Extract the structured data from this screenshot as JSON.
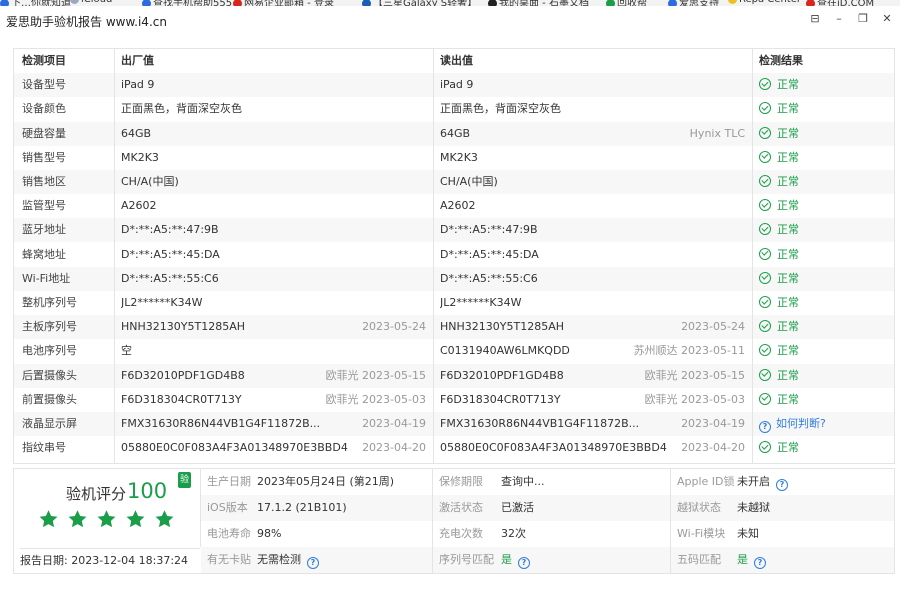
{
  "bookmarks": [
    {
      "label": "下…你就知道",
      "color": "#2b6de0"
    },
    {
      "label": "iCloud",
      "color": "#9aa9c0"
    },
    {
      "label": "查找手机帮助555",
      "color": "#2b6de0"
    },
    {
      "label": "网易企业邮箱 - 登录",
      "color": "#d9261c"
    },
    {
      "label": "【三星Galaxy S轻奢】",
      "color": "#1a5fb4"
    },
    {
      "label": "我的桌面 - 石墨文档",
      "color": "#222222"
    },
    {
      "label": "回收帮",
      "color": "#1a9e4a"
    },
    {
      "label": "爱思支持",
      "color": "#2b6de0"
    },
    {
      "label": "Repa Center",
      "color": "#f0c020"
    },
    {
      "label": "查在iD.COM",
      "color": "#d9261c"
    }
  ],
  "window": {
    "title": "爱思助手验机报告 www.i4.cn",
    "btn_restore": "⊟",
    "btn_min": "–",
    "btn_max": "❐",
    "btn_close": "✕"
  },
  "table": {
    "headers": [
      "检测项目",
      "出厂值",
      "读出值",
      "检测结果"
    ],
    "rows": [
      {
        "item": "设备型号",
        "factory": "iPad 9",
        "factory_meta": "",
        "read": "iPad 9",
        "read_meta": "",
        "result": "正常",
        "status": "ok"
      },
      {
        "item": "设备颜色",
        "factory": "正面黑色，背面深空灰色",
        "factory_meta": "",
        "read": "正面黑色，背面深空灰色",
        "read_meta": "",
        "result": "正常",
        "status": "ok"
      },
      {
        "item": "硬盘容量",
        "factory": "64GB",
        "factory_meta": "",
        "read": "64GB",
        "read_meta": "Hynix TLC",
        "result": "正常",
        "status": "ok"
      },
      {
        "item": "销售型号",
        "factory": "MK2K3",
        "factory_meta": "",
        "read": "MK2K3",
        "read_meta": "",
        "result": "正常",
        "status": "ok"
      },
      {
        "item": "销售地区",
        "factory": "CH/A(中国)",
        "factory_meta": "",
        "read": "CH/A(中国)",
        "read_meta": "",
        "result": "正常",
        "status": "ok"
      },
      {
        "item": "监管型号",
        "factory": "A2602",
        "factory_meta": "",
        "read": "A2602",
        "read_meta": "",
        "result": "正常",
        "status": "ok"
      },
      {
        "item": "蓝牙地址",
        "factory": "D*:**:A5:**:47:9B",
        "factory_meta": "",
        "read": "D*:**:A5:**:47:9B",
        "read_meta": "",
        "result": "正常",
        "status": "ok"
      },
      {
        "item": "蜂窝地址",
        "factory": "D*:**:A5:**:45:DA",
        "factory_meta": "",
        "read": "D*:**:A5:**:45:DA",
        "read_meta": "",
        "result": "正常",
        "status": "ok"
      },
      {
        "item": "Wi-Fi地址",
        "factory": "D*:**:A5:**:55:C6",
        "factory_meta": "",
        "read": "D*:**:A5:**:55:C6",
        "read_meta": "",
        "result": "正常",
        "status": "ok"
      },
      {
        "item": "整机序列号",
        "factory": "JL2******K34W",
        "factory_meta": "",
        "read": "JL2******K34W",
        "read_meta": "",
        "result": "正常",
        "status": "ok"
      },
      {
        "item": "主板序列号",
        "factory": "HNH32130Y5T1285AH",
        "factory_meta": "2023-05-24",
        "read": "HNH32130Y5T1285AH",
        "read_meta": "2023-05-24",
        "result": "正常",
        "status": "ok"
      },
      {
        "item": "电池序列号",
        "factory": "空",
        "factory_meta": "",
        "read": "C0131940AW6LMKQDD",
        "read_meta": "苏州顺达 2023-05-11",
        "result": "正常",
        "status": "ok"
      },
      {
        "item": "后置摄像头",
        "factory": "F6D32010PDF1GD4B8",
        "factory_meta": "欧菲光 2023-05-15",
        "read": "F6D32010PDF1GD4B8",
        "read_meta": "欧菲光 2023-05-15",
        "result": "正常",
        "status": "ok"
      },
      {
        "item": "前置摄像头",
        "factory": "F6D318304CR0T713Y",
        "factory_meta": "欧菲光 2023-05-03",
        "read": "F6D318304CR0T713Y",
        "read_meta": "欧菲光 2023-05-03",
        "result": "正常",
        "status": "ok"
      },
      {
        "item": "液晶显示屏",
        "factory": "FMX31630R86N44VB1G4F11872B...",
        "factory_meta": "2023-04-19",
        "read": "FMX31630R86N44VB1G4F11872B...",
        "read_meta": "2023-04-19",
        "result": "如何判断?",
        "status": "question"
      },
      {
        "item": "指纹串号",
        "factory": "05880E0C0F083A4F3A01348970E3BBD4",
        "factory_meta": "2023-04-20",
        "read": "05880E0C0F083A4F3A01348970E3BBD4",
        "read_meta": "2023-04-20",
        "result": "正常",
        "status": "ok"
      }
    ]
  },
  "summary": {
    "score_label": "验机评分",
    "score_value": "100",
    "verified_badge": "验",
    "stars": 5,
    "report_date_label": "报告日期:",
    "report_date": "2023-12-04 18:37:24",
    "rows": [
      [
        {
          "label": "生产日期",
          "value": "2023年05月24日 (第21周)",
          "style": "sv",
          "help": false
        },
        {
          "label": "保修期限",
          "value": "查询中...",
          "style": "sv",
          "help": false
        },
        {
          "label": "Apple ID锁",
          "value": "未开启",
          "style": "sv",
          "help": true
        }
      ],
      [
        {
          "label": "iOS版本",
          "value": "17.1.2 (21B101)",
          "style": "sv",
          "help": false
        },
        {
          "label": "激活状态",
          "value": "已激活",
          "style": "sv",
          "help": false
        },
        {
          "label": "越狱状态",
          "value": "未越狱",
          "style": "sv",
          "help": false
        }
      ],
      [
        {
          "label": "电池寿命",
          "value": "98%",
          "style": "sv",
          "help": false
        },
        {
          "label": "充电次数",
          "value": "32次",
          "style": "sv",
          "help": false
        },
        {
          "label": "Wi-Fi模块",
          "value": "未知",
          "style": "sv",
          "help": false
        }
      ],
      [
        {
          "label": "有无卡贴",
          "value": "无需检测",
          "style": "sv",
          "help": true
        },
        {
          "label": "序列号匹配",
          "value": "是",
          "style": "sg",
          "help": true
        },
        {
          "label": "五码匹配",
          "value": "是",
          "style": "sg",
          "help": true
        }
      ]
    ]
  },
  "colors": {
    "ok": "#1a9e4a",
    "link": "#2f7de1",
    "star": "#1a9e4a"
  },
  "icons": {
    "ok": "check-circle-icon",
    "question": "question-circle-icon",
    "star": "star-icon"
  }
}
